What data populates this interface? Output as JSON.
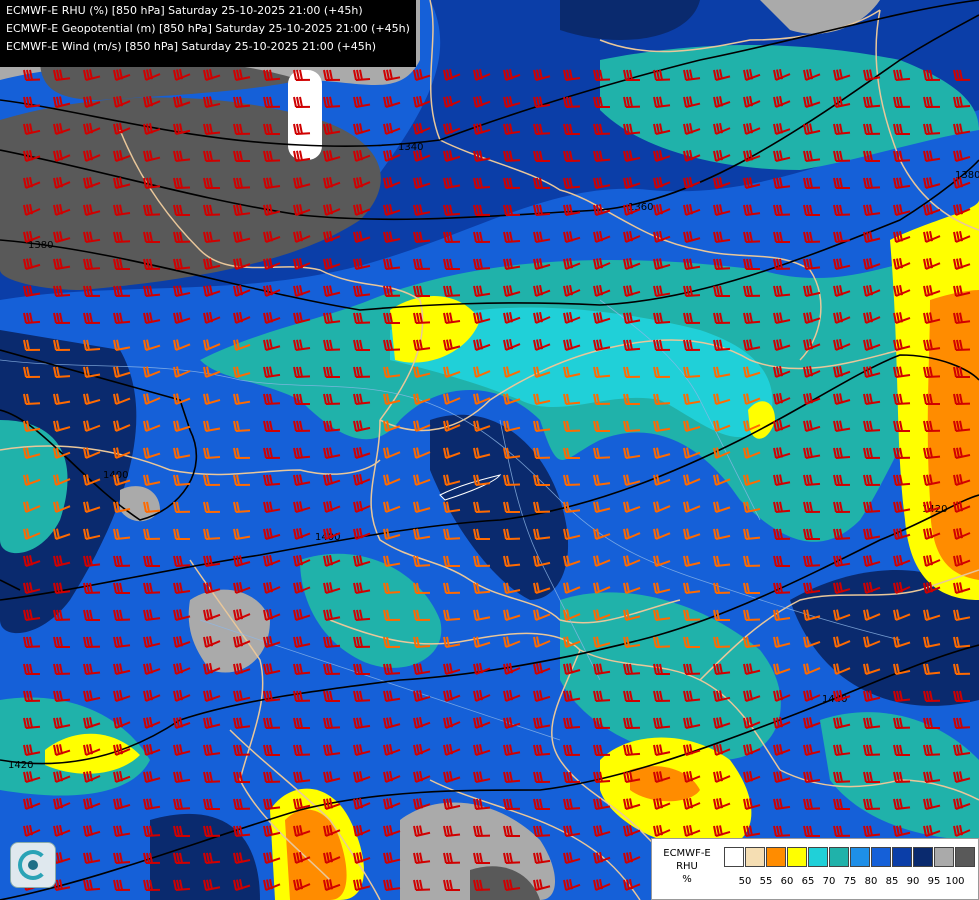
{
  "header": {
    "line1": "ECMWF-E RHU (%) [850 hPa] Saturday 25-10-2025 21:00 (+45h)",
    "line2": "ECMWF-E Geopotential (m) [850 hPa] Saturday 25-10-2025 21:00 (+45h)",
    "line3": "ECMWF-E Wind (m/s) [850 hPa] Saturday 25-10-2025 21:00 (+45h)"
  },
  "contours": {
    "labels": [
      "1340",
      "1360",
      "1380",
      "1380",
      "1400",
      "1400",
      "1420",
      "1420",
      "1440"
    ]
  },
  "legend": {
    "model": "ECMWF-E",
    "variable": "RHU",
    "unit": "%",
    "ticks": [
      "50",
      "55",
      "60",
      "65",
      "70",
      "75",
      "80",
      "85",
      "90",
      "95",
      "100"
    ],
    "colors": [
      "#ffffff",
      "#f5deb3",
      "#ff8c00",
      "#ffff00",
      "#20d0d8",
      "#20b2aa",
      "#1e8fe8",
      "#1560d8",
      "#0b3ea8",
      "#0a2a6e",
      "#aaaaaa",
      "#595959"
    ]
  },
  "colors": {
    "wind_red": "#d00000",
    "wind_orange": "#ff6a00",
    "wind_pink": "#ffc0cb",
    "border": "#e9c79a",
    "contour": "#000000"
  }
}
